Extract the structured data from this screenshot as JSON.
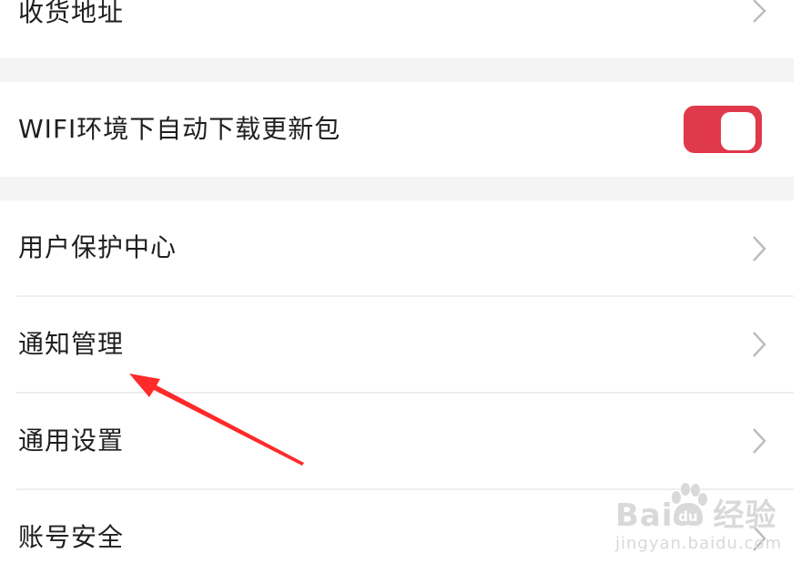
{
  "rows": {
    "address": {
      "label": "收货地址"
    },
    "wifi_download": {
      "label": "WIFI环境下自动下载更新包",
      "enabled": true
    },
    "user_protection": {
      "label": "用户保护中心"
    },
    "notifications": {
      "label": "通知管理"
    },
    "general": {
      "label": "通用设置"
    },
    "account_security": {
      "label": "账号安全"
    }
  },
  "colors": {
    "accent": "#e0394b",
    "gap_background": "#f4f4f4",
    "chevron": "#bdbdbd",
    "annotation_arrow": "#ff2a2a"
  },
  "watermark": {
    "logo_left": "Bai",
    "logo_right": "经验",
    "url": "jingyan.baidu.com"
  }
}
